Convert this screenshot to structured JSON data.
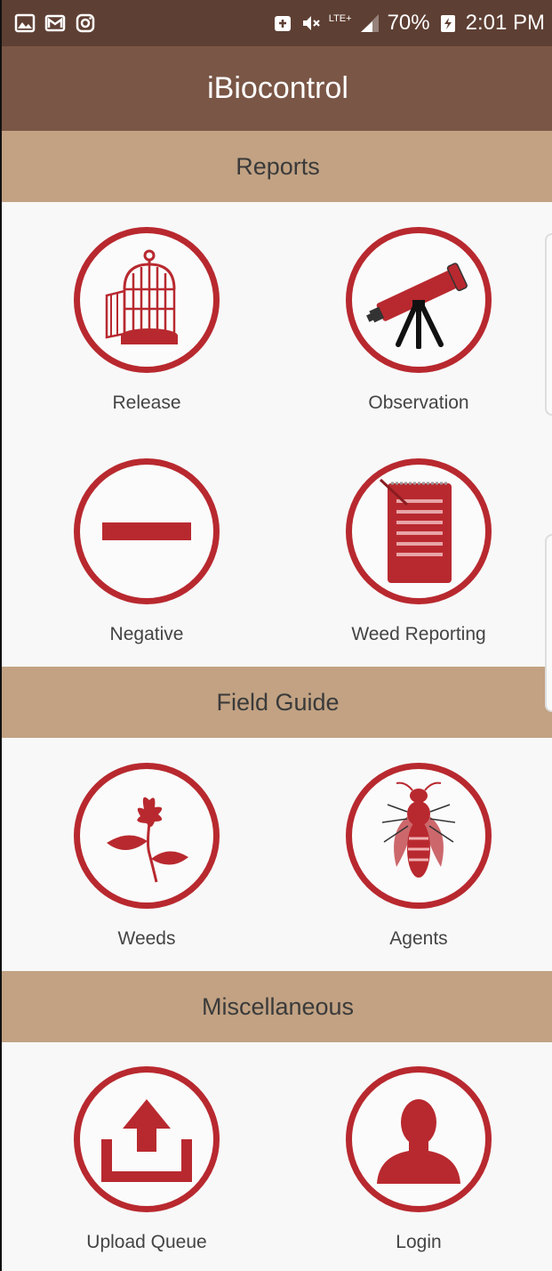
{
  "status_bar": {
    "icons_left": [
      "gallery-icon",
      "mail-icon",
      "instagram-icon"
    ],
    "network": "LTE+",
    "battery": "70%",
    "time": "2:01 PM"
  },
  "app_bar": {
    "title": "iBiocontrol"
  },
  "sections": {
    "reports": {
      "title": "Reports",
      "tiles": [
        {
          "label": "Release",
          "icon": "birdcage-icon"
        },
        {
          "label": "Observation",
          "icon": "telescope-icon"
        },
        {
          "label": "Negative",
          "icon": "minus-icon"
        },
        {
          "label": "Weed Reporting",
          "icon": "notepad-icon"
        }
      ]
    },
    "field_guide": {
      "title": "Field Guide",
      "tiles": [
        {
          "label": "Weeds",
          "icon": "plant-icon"
        },
        {
          "label": "Agents",
          "icon": "insect-icon"
        }
      ]
    },
    "misc": {
      "title": "Miscellaneous",
      "tiles": [
        {
          "label": "Upload Queue",
          "icon": "upload-icon"
        },
        {
          "label": "Login",
          "icon": "user-icon"
        }
      ]
    }
  },
  "colors": {
    "status_bar": "#5e3f33",
    "app_bar": "#7a5646",
    "section_header": "#c2a283",
    "accent": "#b8292f"
  }
}
